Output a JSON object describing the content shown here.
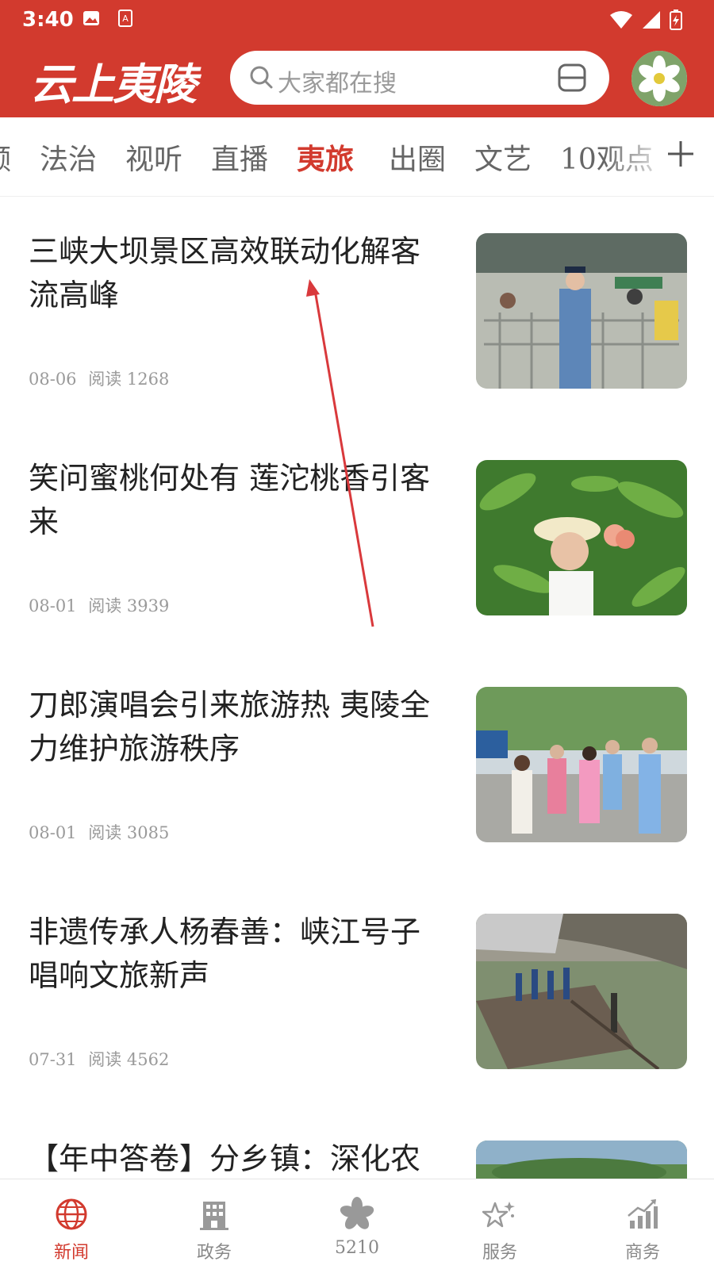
{
  "status_bar": {
    "time": "3:40"
  },
  "header": {
    "logo_text": "云上夷陵",
    "search_placeholder": "大家都在搜"
  },
  "tabs": [
    {
      "label": "频"
    },
    {
      "label": "法治"
    },
    {
      "label": "视听"
    },
    {
      "label": "直播"
    },
    {
      "label": "夷旅",
      "active": true
    },
    {
      "label": "出圈"
    },
    {
      "label": "文艺"
    },
    {
      "label": "10观点"
    }
  ],
  "news": [
    {
      "title": "三峡大坝景区高效联动化解客流高峰",
      "date": "08-06",
      "reads": "阅读 1268"
    },
    {
      "title": "笑问蜜桃何处有 莲沱桃香引客来",
      "date": "08-01",
      "reads": "阅读 3939"
    },
    {
      "title": "刀郎演唱会引来旅游热 夷陵全力维护旅游秩序",
      "date": "08-01",
      "reads": "阅读 3085"
    },
    {
      "title": "非遗传承人杨春善：峡江号子唱响文旅新声",
      "date": "07-31",
      "reads": "阅读 4562"
    },
    {
      "title": "【年中答卷】分乡镇：深化农",
      "date": "",
      "reads": ""
    }
  ],
  "bottom_nav": [
    {
      "label": "新闻",
      "icon": "globe-icon",
      "active": true
    },
    {
      "label": "政务",
      "icon": "building-icon"
    },
    {
      "label": "5210",
      "icon": "flower-icon"
    },
    {
      "label": "服务",
      "icon": "star-sparkle-icon"
    },
    {
      "label": "商务",
      "icon": "chart-up-icon"
    }
  ],
  "colors": {
    "brand_red": "#d23a2e",
    "meta_gray": "#9a9a9a",
    "title_text": "#222222"
  }
}
